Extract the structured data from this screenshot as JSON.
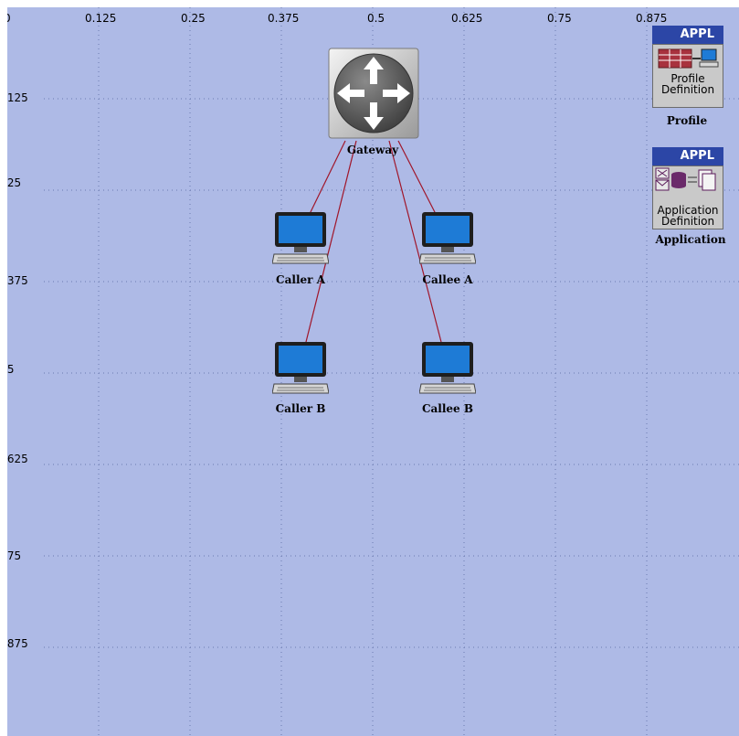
{
  "grid": {
    "x_ticks": [
      "0",
      "0.125",
      "0.25",
      "0.375",
      "0.5",
      "0.625",
      "0.75",
      "0.875"
    ],
    "y_ticks": [
      ".125",
      ".25",
      ".375",
      ".5",
      ".625",
      ".75",
      ".875"
    ],
    "background_color": "#aebae6",
    "grid_color": "#6b7bb0",
    "link_color": "#a0162a"
  },
  "nodes": {
    "gateway": {
      "label": "Gateway",
      "icon": "router-icon"
    },
    "caller_a": {
      "label": "Caller A",
      "icon": "workstation-icon"
    },
    "callee_a": {
      "label": "Callee A",
      "icon": "workstation-icon"
    },
    "caller_b": {
      "label": "Caller B",
      "icon": "workstation-icon"
    },
    "callee_b": {
      "label": "Callee B",
      "icon": "workstation-icon"
    }
  },
  "config_objects": {
    "profile": {
      "badge": "APPL",
      "line1": "Profile",
      "line2": "Definition",
      "label": "Profile",
      "icon": "profile-config-icon"
    },
    "application": {
      "badge": "APPL",
      "line1": "Application",
      "line2": "Definition",
      "label": "Application",
      "icon": "application-config-icon"
    }
  }
}
